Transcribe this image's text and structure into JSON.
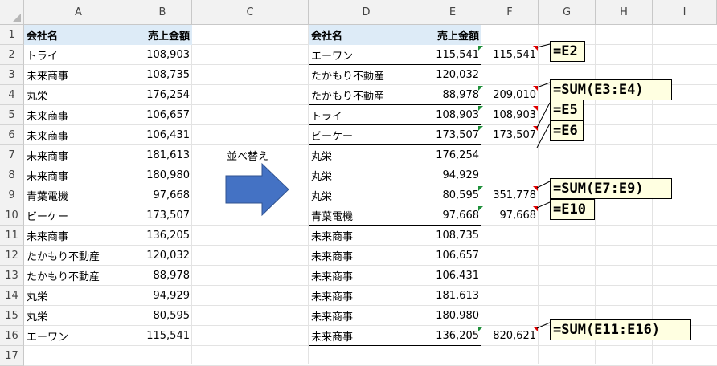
{
  "columns": [
    "A",
    "B",
    "C",
    "D",
    "E",
    "F",
    "G",
    "H",
    "I"
  ],
  "rows": [
    "1",
    "2",
    "3",
    "4",
    "5",
    "6",
    "7",
    "8",
    "9",
    "10",
    "11",
    "12",
    "13",
    "14",
    "15",
    "16",
    "17"
  ],
  "left_table": {
    "header": {
      "company": "会社名",
      "sales": "売上金額"
    },
    "rows": [
      {
        "company": "トライ",
        "sales": "108,903"
      },
      {
        "company": "未来商事",
        "sales": "108,735"
      },
      {
        "company": "丸栄",
        "sales": "176,254"
      },
      {
        "company": "未来商事",
        "sales": "106,657"
      },
      {
        "company": "未来商事",
        "sales": "106,431"
      },
      {
        "company": "未来商事",
        "sales": "181,613"
      },
      {
        "company": "未来商事",
        "sales": "180,980"
      },
      {
        "company": "青葉電機",
        "sales": "97,668"
      },
      {
        "company": "ビーケー",
        "sales": "173,507"
      },
      {
        "company": "未来商事",
        "sales": "136,205"
      },
      {
        "company": "たかもり不動産",
        "sales": "120,032"
      },
      {
        "company": "たかもり不動産",
        "sales": "88,978"
      },
      {
        "company": "丸栄",
        "sales": "94,929"
      },
      {
        "company": "丸栄",
        "sales": "80,595"
      },
      {
        "company": "エーワン",
        "sales": "115,541"
      }
    ]
  },
  "sort_label": "並べ替え",
  "right_table": {
    "header": {
      "company": "会社名",
      "sales": "売上金額"
    },
    "rows": [
      {
        "company": "エーワン",
        "sales": "115,541",
        "subtotal": "115,541"
      },
      {
        "company": "たかもり不動産",
        "sales": "120,032",
        "subtotal": ""
      },
      {
        "company": "たかもり不動産",
        "sales": "88,978",
        "subtotal": "209,010"
      },
      {
        "company": "トライ",
        "sales": "108,903",
        "subtotal": "108,903"
      },
      {
        "company": "ビーケー",
        "sales": "173,507",
        "subtotal": "173,507"
      },
      {
        "company": "丸栄",
        "sales": "176,254",
        "subtotal": ""
      },
      {
        "company": "丸栄",
        "sales": "94,929",
        "subtotal": ""
      },
      {
        "company": "丸栄",
        "sales": "80,595",
        "subtotal": "351,778"
      },
      {
        "company": "青葉電機",
        "sales": "97,668",
        "subtotal": "97,668"
      },
      {
        "company": "未来商事",
        "sales": "108,735",
        "subtotal": ""
      },
      {
        "company": "未来商事",
        "sales": "106,657",
        "subtotal": ""
      },
      {
        "company": "未来商事",
        "sales": "106,431",
        "subtotal": ""
      },
      {
        "company": "未来商事",
        "sales": "181,613",
        "subtotal": ""
      },
      {
        "company": "未来商事",
        "sales": "180,980",
        "subtotal": ""
      },
      {
        "company": "未来商事",
        "sales": "136,205",
        "subtotal": "820,621"
      }
    ]
  },
  "notes": [
    "=E2",
    "=SUM(E3:E4)",
    "=E5",
    "=E6",
    "=SUM(E7:E9)",
    "=E10",
    "=SUM(E11:E16)"
  ],
  "colors": {
    "header_fill": "#ddebf7",
    "arrow": "#4472c4",
    "note_fill": "#ffffe1"
  }
}
